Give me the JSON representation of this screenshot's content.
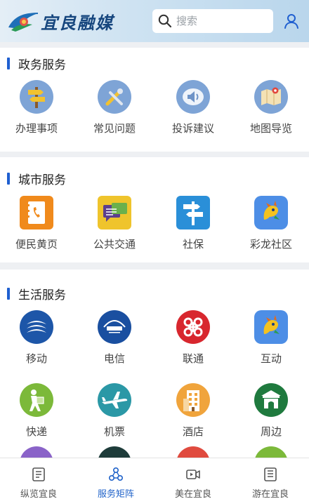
{
  "header": {
    "logo_text": "宜良融媒",
    "search_placeholder": "搜索",
    "icons": {
      "search": "search-icon",
      "user": "user-icon"
    }
  },
  "sections": [
    {
      "title": "政务服务",
      "items": [
        {
          "label": "办理事项",
          "icon": "signpost-icon"
        },
        {
          "label": "常见问题",
          "icon": "tools-icon"
        },
        {
          "label": "投诉建议",
          "icon": "megaphone-icon"
        },
        {
          "label": "地图导览",
          "icon": "map-icon"
        }
      ]
    },
    {
      "title": "城市服务",
      "items": [
        {
          "label": "便民黄页",
          "icon": "phonebook-icon"
        },
        {
          "label": "公共交通",
          "icon": "chat-icon"
        },
        {
          "label": "社保",
          "icon": "direction-sign-icon"
        },
        {
          "label": "彩龙社区",
          "icon": "dragon-icon"
        }
      ]
    },
    {
      "title": "生活服务",
      "items": [
        {
          "label": "移动",
          "icon": "china-mobile-icon"
        },
        {
          "label": "电信",
          "icon": "china-telecom-icon"
        },
        {
          "label": "联通",
          "icon": "china-unicom-icon"
        },
        {
          "label": "互动",
          "icon": "dragon-icon"
        },
        {
          "label": "快递",
          "icon": "courier-icon"
        },
        {
          "label": "机票",
          "icon": "airplane-icon"
        },
        {
          "label": "酒店",
          "icon": "hotel-icon"
        },
        {
          "label": "周边",
          "icon": "landmark-icon"
        }
      ]
    }
  ],
  "bottom_nav": [
    {
      "label": "纵览宜良",
      "icon": "news-icon",
      "active": false
    },
    {
      "label": "服务矩阵",
      "icon": "matrix-icon",
      "active": true
    },
    {
      "label": "美在宜良",
      "icon": "video-icon",
      "active": false
    },
    {
      "label": "游在宜良",
      "icon": "guide-icon",
      "active": false
    }
  ],
  "colors": {
    "accent": "#1f62c9",
    "section_bar": "#1f5fd0",
    "header_gradient_start": "#e4eef6",
    "header_gradient_end": "#b9d6ec"
  }
}
